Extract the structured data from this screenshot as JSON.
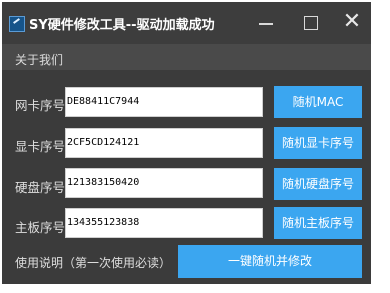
{
  "window": {
    "title": "SY硬件修改工具--驱动加载成功",
    "controls": {
      "minimize": "minimize-icon",
      "maximize": "maximize-icon",
      "close": "close-icon",
      "close_glyph": "✕"
    }
  },
  "menu": {
    "about": "关于我们"
  },
  "rows": [
    {
      "label": "网卡序号",
      "value": "DE88411C7944",
      "button": "随机MAC"
    },
    {
      "label": "显卡序号",
      "value": "2CF5CD124121",
      "button": "随机显卡序号"
    },
    {
      "label": "硬盘序号",
      "value": "121383150420",
      "button": "随机硬盘序号"
    },
    {
      "label": "主板序号",
      "value": "134355123838",
      "button": "随机主板序号"
    }
  ],
  "footer": {
    "help": "使用说明（第一次使用必读）",
    "main_button": "一键随机并修改"
  },
  "colors": {
    "accent": "#3ba6f0",
    "background": "#3b3b3b",
    "titlebar": "#3d3d3d"
  }
}
